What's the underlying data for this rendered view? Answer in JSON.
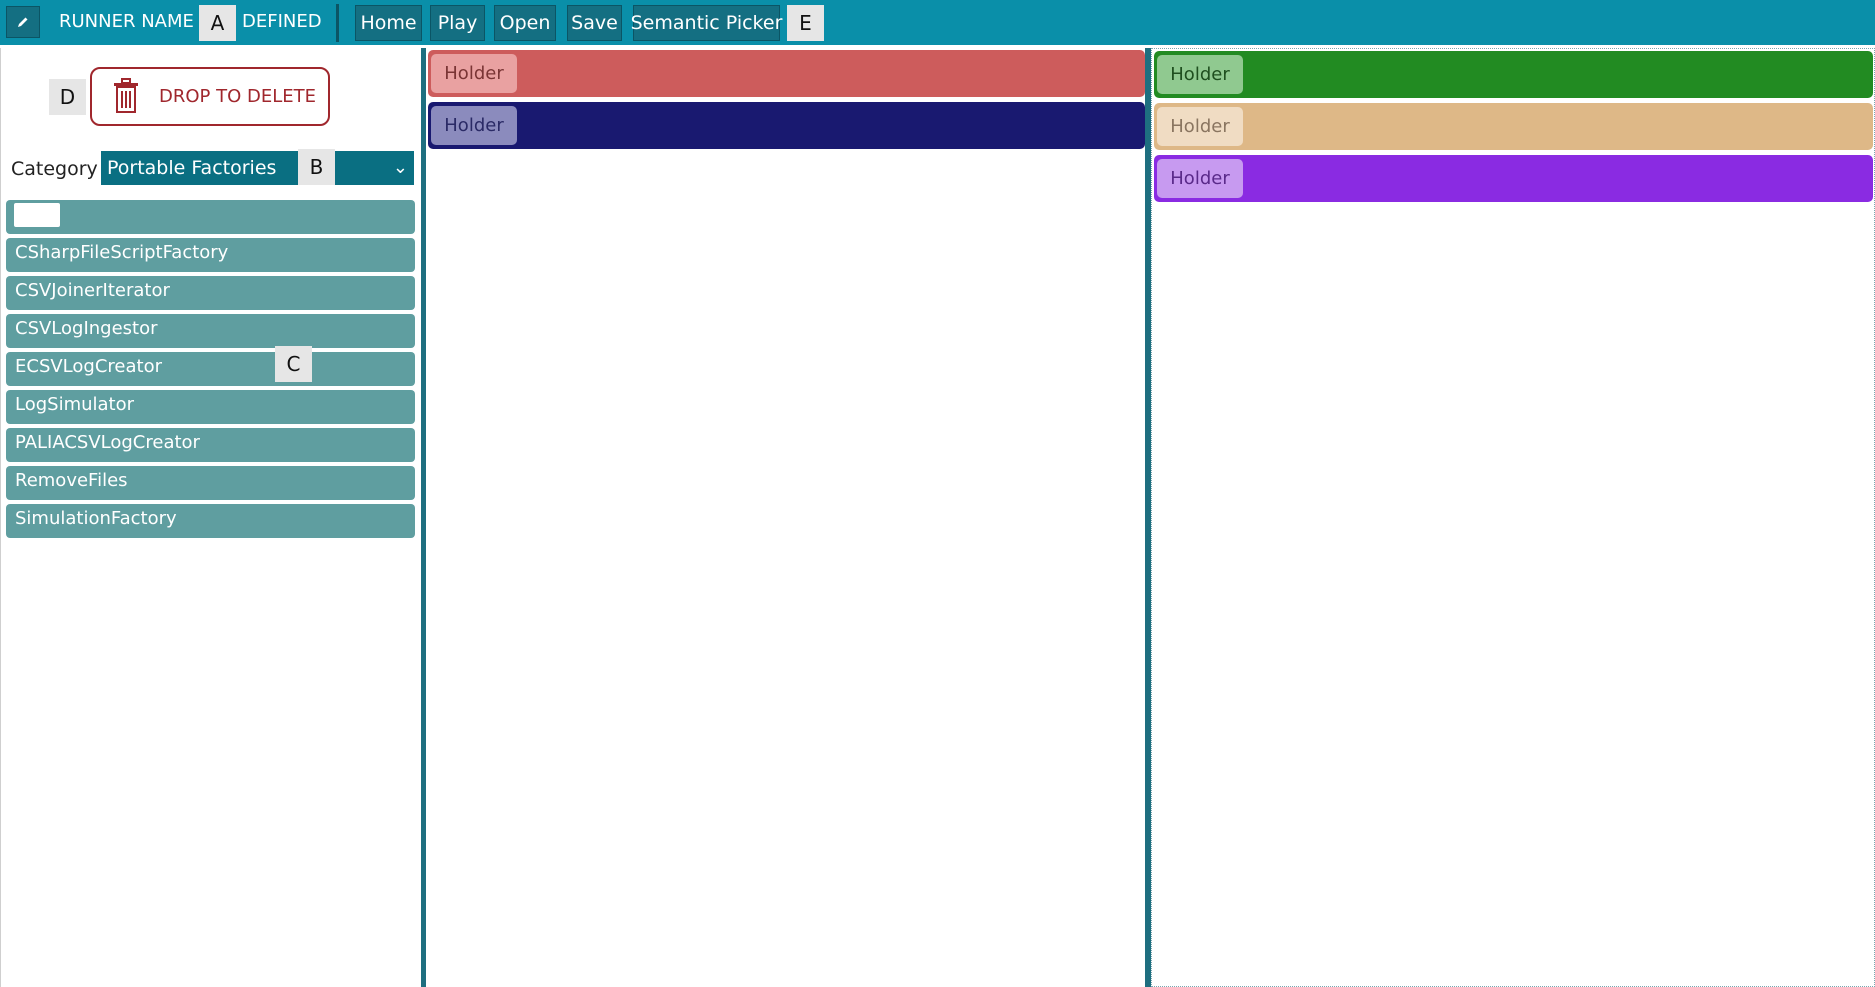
{
  "topbar": {
    "edit_icon": "pencil-icon",
    "runner_label": "RUNNER NAME",
    "marker_a": "A",
    "defined_label": "DEFINED",
    "buttons": [
      "Home",
      "Play",
      "Open",
      "Save",
      "Semantic Picker"
    ],
    "marker_e": "E"
  },
  "left": {
    "marker_d": "D",
    "delete_icon": "trash-icon",
    "delete_label": "DROP TO DELETE",
    "category_label": "Category",
    "category_value": "Portable Factories",
    "marker_b": "B",
    "chevron_icon": "chevron-down-icon",
    "search_value": "",
    "marker_c": "C",
    "factories": [
      "CSharpFileScriptFactory",
      "CSVJoinerIterator",
      "CSVLogIngestor",
      "ECSVLogCreator",
      "LogSimulator",
      "PALIACSVLogCreator",
      "RemoveFiles",
      "SimulationFactory"
    ]
  },
  "center": {
    "holders": [
      {
        "label": "Holder",
        "color": "#cd5c5c",
        "chip": "#e9a1a1",
        "text": "#7a3535"
      },
      {
        "label": "Holder",
        "color": "#191970",
        "chip": "#8b8bbd",
        "text": "#2a2a66"
      }
    ]
  },
  "right": {
    "holders": [
      {
        "label": "Holder",
        "color": "#228b22",
        "chip": "#90c990",
        "text": "#1f4f1f"
      },
      {
        "label": "Holder",
        "color": "#deb887",
        "chip": "#f0dcc3",
        "text": "#8a7560"
      },
      {
        "label": "Holder",
        "color": "#8a2be2",
        "chip": "#c79af0",
        "text": "#5a2a8a"
      }
    ]
  }
}
